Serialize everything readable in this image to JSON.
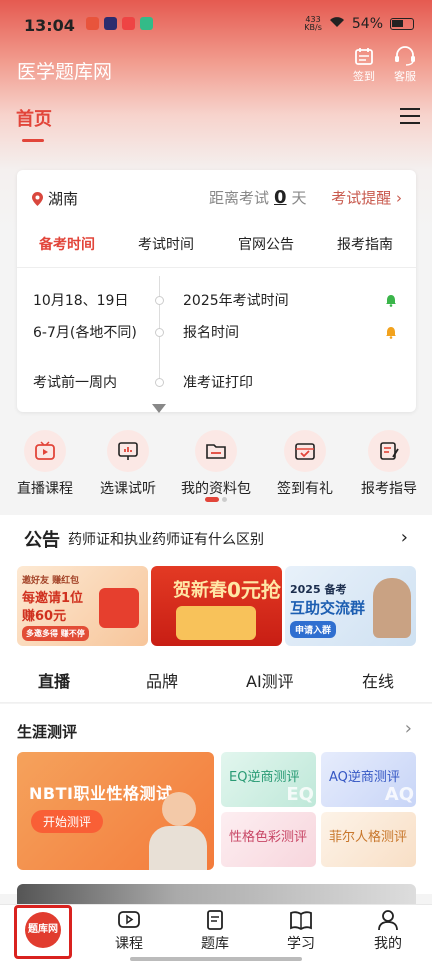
{
  "status_bar": {
    "time": "13:04",
    "speed": "433",
    "speed_unit": "KB/s",
    "battery": "54%"
  },
  "header": {
    "app_title": "医学题库网",
    "checkin_label": "签到",
    "service_label": "客服"
  },
  "tabs": {
    "home_label": "首页"
  },
  "exam_card": {
    "location": "湖南",
    "distance_prefix": "距离考试",
    "days": "0",
    "days_unit": "天",
    "reminder": "考试提醒",
    "subtabs": [
      "备考时间",
      "考试时间",
      "官网公告",
      "报考指南"
    ],
    "timeline": [
      {
        "date": "10月18、19日",
        "event": "2025年考试时间",
        "bell_color": "#3ab54a"
      },
      {
        "date": "6-7月(各地不同)",
        "event": "报名时间",
        "bell_color": "#f2a21d"
      },
      {
        "date": "考试前一周内",
        "event": "准考证打印",
        "bell_color": ""
      }
    ]
  },
  "quick_links": [
    {
      "label": "直播课程",
      "icon": "tv-play-icon"
    },
    {
      "label": "选课试听",
      "icon": "chart-board-icon"
    },
    {
      "label": "我的资料包",
      "icon": "folder-icon"
    },
    {
      "label": "签到有礼",
      "icon": "calendar-check-icon"
    },
    {
      "label": "报考指导",
      "icon": "document-edit-icon"
    }
  ],
  "notice": {
    "tag": "公告",
    "text": "药师证和执业药师证有什么区别",
    "arrow": "›"
  },
  "banners": {
    "b1_line1": "邀好友 赚红包",
    "b1_line2": "每邀请1位",
    "b1_line3": "赚60元",
    "b1_line4": "多邀多得 赚不停",
    "b2_line1": "贺新春",
    "b2_line2": "0元抢",
    "b3_line1": "2025 备考",
    "b3_line2": "互助交流群",
    "b3_line3": "申请入群"
  },
  "categories": [
    "直播",
    "品牌",
    "AI测评",
    "在线"
  ],
  "career": {
    "title": "生涯测评",
    "big_title": "NBTI职业性格测试",
    "big_button": "开始测评",
    "tests": [
      {
        "label": "EQ逆商测评",
        "badge": "EQ"
      },
      {
        "label": "AQ逆商测评",
        "badge": "AQ"
      },
      {
        "label": "性格色彩测评",
        "badge": ""
      },
      {
        "label": "菲尔人格测评",
        "badge": ""
      }
    ]
  },
  "bottom_nav": {
    "logo_text": "题库网",
    "items": [
      "课程",
      "题库",
      "学习",
      "我的"
    ]
  },
  "colors": {
    "accent": "#e2453a",
    "highlight_border": "#d9221f"
  }
}
